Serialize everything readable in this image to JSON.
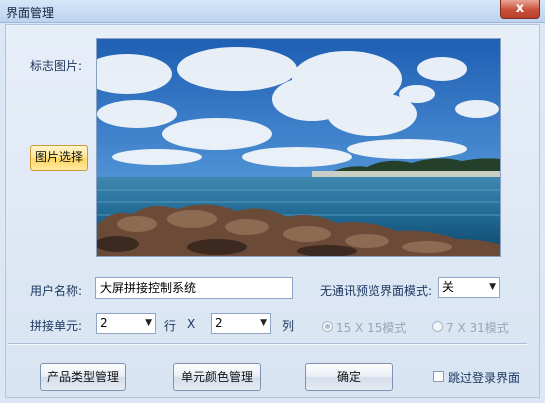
{
  "window": {
    "title": "界面管理",
    "close_icon": "close-icon",
    "close_glyph": "x"
  },
  "logo": {
    "label": "标志图片:",
    "choose_button": "图片选择",
    "image": "seascape-photo",
    "image_colors": {
      "sky": "#3f82c9",
      "cloud": "#f3f6fa",
      "sea": "#1f5f8c",
      "rock": "#6b4a38"
    }
  },
  "user_name": {
    "label": "用户名称:",
    "value": "大屏拼接控制系统"
  },
  "tiles": {
    "label": "拼接单元:",
    "rows_value": "2",
    "rows_unit": "行",
    "x_sep": "X",
    "cols_value": "2",
    "cols_unit": "列"
  },
  "offline_mode": {
    "label": "无通讯预览界面模式:",
    "value": "关",
    "options": [
      {
        "label": "15 X 15模式",
        "selected": true
      },
      {
        "label": "7 X 31模式",
        "selected": false
      }
    ]
  },
  "buttons": {
    "product_type": "产品类型管理",
    "unit_color": "单元颜色管理",
    "ok": "确定"
  },
  "skip_login": {
    "label": "跳过登录界面",
    "checked": false
  },
  "accent_color": "#ffd65c"
}
